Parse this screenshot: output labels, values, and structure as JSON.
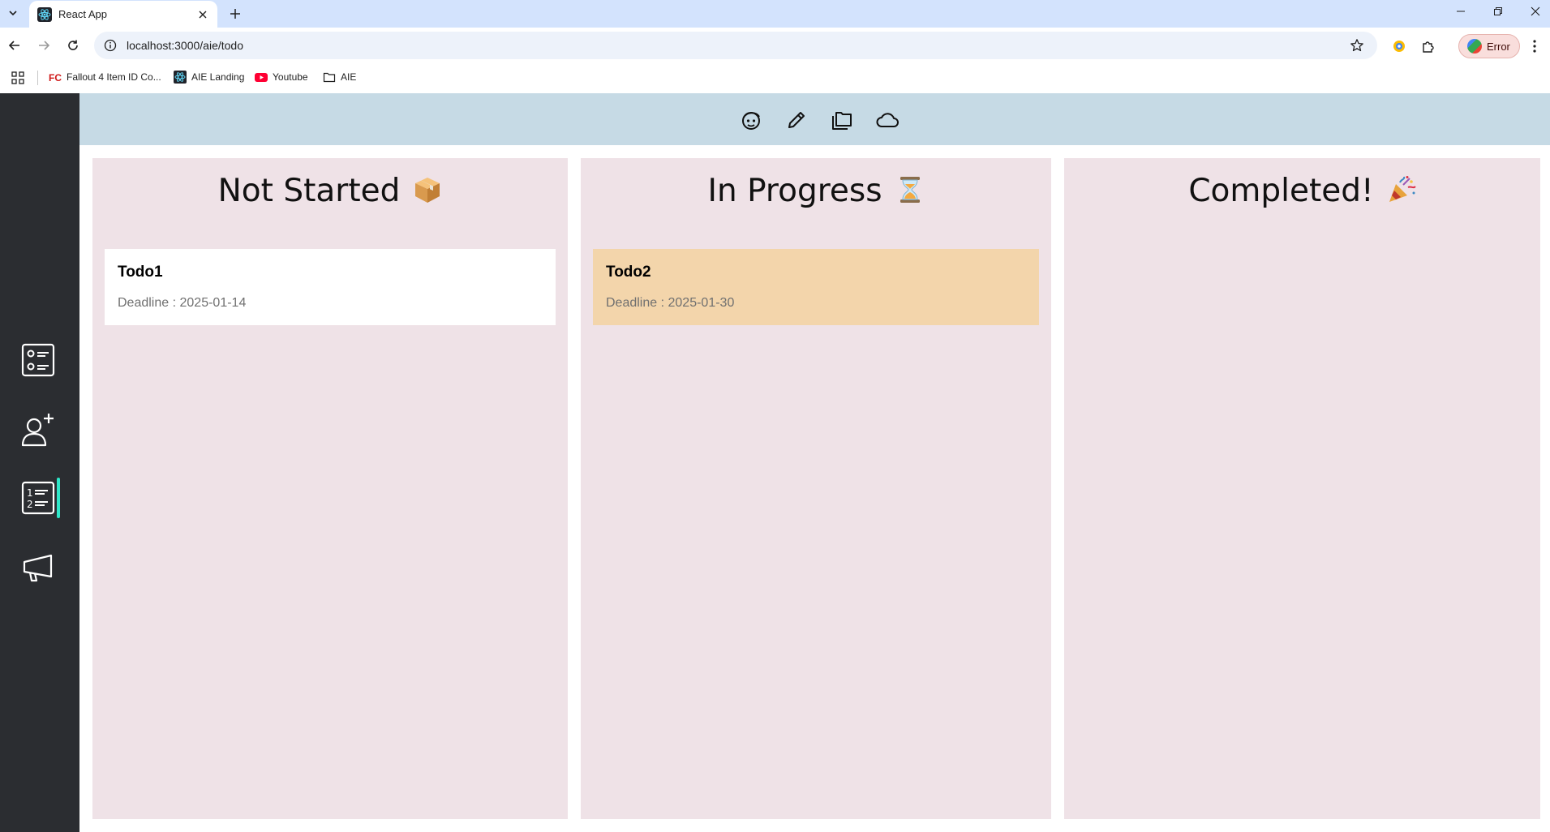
{
  "browser": {
    "tab_title": "React App",
    "url": "localhost:3000/aie/todo",
    "profile_label": "Error",
    "bookmarks": [
      {
        "label": "Fallout 4 Item ID Co...",
        "icon": "fc-favicon"
      },
      {
        "label": "AIE Landing",
        "icon": "react-favicon"
      },
      {
        "label": "Youtube",
        "icon": "youtube-favicon"
      },
      {
        "label": "AIE",
        "icon": "folder-icon"
      }
    ]
  },
  "sidebar": {
    "items": [
      {
        "name": "checklist",
        "icon": "checklist-icon",
        "active": false
      },
      {
        "name": "add-user",
        "icon": "add-user-icon",
        "active": false
      },
      {
        "name": "todo",
        "icon": "numbered-list-icon",
        "active": true
      },
      {
        "name": "announcements",
        "icon": "megaphone-icon",
        "active": false
      }
    ]
  },
  "topnav": {
    "icons": [
      "face-icon",
      "pencil-icon",
      "folders-icon",
      "cloud-icon"
    ]
  },
  "board": {
    "columns": [
      {
        "title": "Not Started",
        "emoji": "package-emoji",
        "cards": [
          {
            "title": "Todo1",
            "deadline": "Deadline : 2025-01-14",
            "color": "#ffffff"
          }
        ]
      },
      {
        "title": "In Progress",
        "emoji": "hourglass-emoji",
        "cards": [
          {
            "title": "Todo2",
            "deadline": "Deadline : 2025-01-30",
            "color": "#f3d5ab"
          }
        ]
      },
      {
        "title": "Completed!",
        "emoji": "party-popper-emoji",
        "cards": []
      }
    ]
  },
  "colors": {
    "sidebar_bg": "#2b2d31",
    "sidebar_active": "#2ee6c8",
    "topnav_bg": "#c6dae5",
    "column_bg": "#efe2e7"
  }
}
